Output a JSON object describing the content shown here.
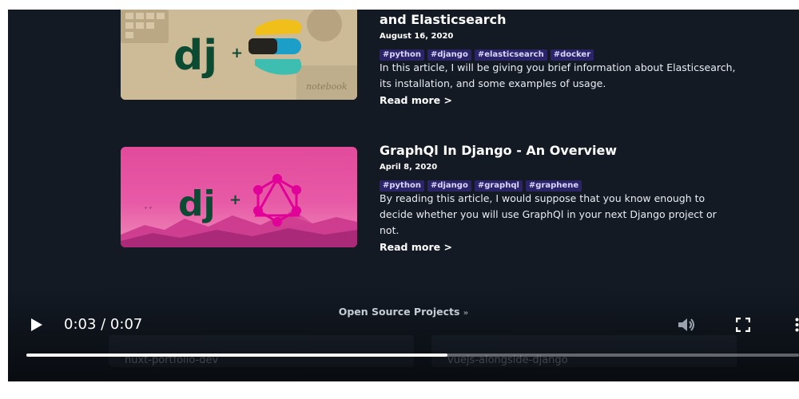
{
  "articles": [
    {
      "title": "and Elasticsearch",
      "date": "August 16, 2020",
      "tags": [
        "#python",
        "#django",
        "#elasticsearch",
        "#docker"
      ],
      "excerpt_lines": [
        "In this article, I will be giving you brief information about Elasticsearch,",
        "its installation, and some examples of usage."
      ],
      "read_more": "Read more >",
      "thumb": {
        "logo": "dj",
        "plus": "+",
        "caption": "notebook"
      }
    },
    {
      "title": "GraphQl In Django - An Overview",
      "date": "April 8, 2020",
      "tags": [
        "#python",
        "#django",
        "#graphql",
        "#graphene"
      ],
      "excerpt_lines": [
        "By reading this article, I would suppose that you know enough to",
        "decide whether you will use GraphQl in your next Django project or",
        "not."
      ],
      "read_more": "Read more >",
      "thumb": {
        "logo": "dj",
        "plus": "+"
      }
    }
  ],
  "section": {
    "heading": "Open Source Projects",
    "heading_icon": "chevron-double-down-icon"
  },
  "projects": [
    {
      "name": "nuxt-portfolio-dev"
    },
    {
      "name": "vuejs-alongside-django"
    }
  ],
  "player": {
    "time": "0:03 / 0:07",
    "progress": 0.545,
    "icons": {
      "play": "play-icon",
      "volume": "volume-icon",
      "fullscreen": "fullscreen-icon",
      "more": "more-icon"
    }
  },
  "colors": {
    "background": "#131a24",
    "tag_bg": "#2c2468",
    "django_green": "#0c4b33",
    "graphql_pink": "#e10098"
  }
}
